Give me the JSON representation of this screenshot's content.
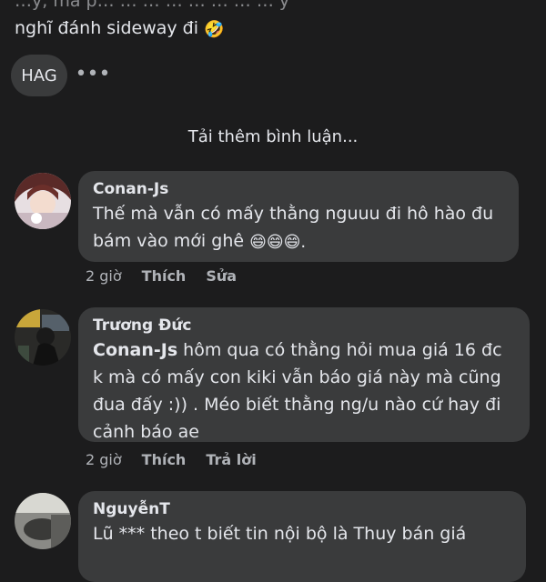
{
  "post": {
    "line1": "…y, mà p… … … … … … … … y",
    "line2": "nghĩ đánh sideway đi",
    "line2_emoji": "🤣",
    "chip_label": "HAG",
    "more_icon": "•••"
  },
  "load_more_label": "Tải thêm bình luận...",
  "comments": [
    {
      "author": "Conan-Js",
      "text": "Thế mà vẫn có mấy thằng nguuu đi hô hào đu bám vào mới ghê",
      "emojis": "😄😄😄.",
      "time": "2 giờ",
      "like": "Thích",
      "action": "Sửa"
    },
    {
      "author": "Trương Đức",
      "tag": "Conan-Js",
      "text": " hôm qua có thằng hỏi mua giá 16 đc k mà có mấy con kiki vẫn báo giá này mà cũng đua đấy :)) . Méo biết thằng ng/u nào cứ hay đi cảnh báo ae",
      "time": "2 giờ",
      "like": "Thích",
      "action": "Trả lời"
    },
    {
      "author": "NguyễnT",
      "text": "Lũ *** theo t biết tin nội bộ là Thuy bán giá"
    }
  ]
}
